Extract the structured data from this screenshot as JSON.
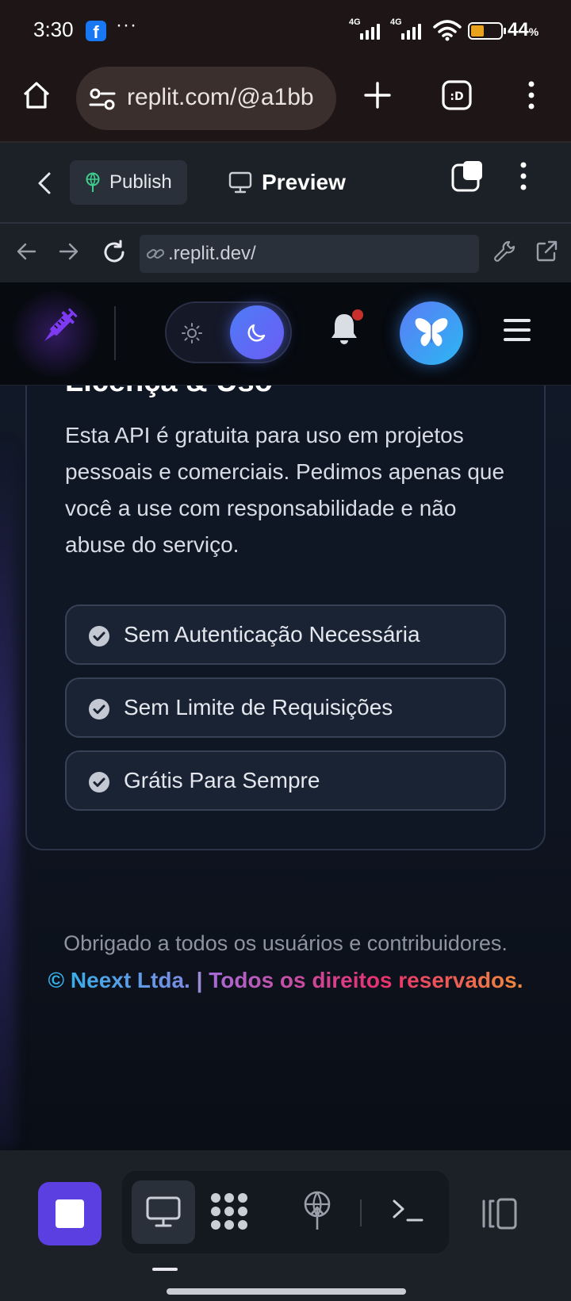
{
  "status_bar": {
    "time": "3:30",
    "more": "···",
    "sim1_label": "4G",
    "sim2_label": "4G",
    "battery_percent": "44",
    "battery_unit": "%",
    "battery_level": 0.44
  },
  "browser": {
    "url": "replit.com/@a1bb"
  },
  "replit_header": {
    "publish_label": "Publish",
    "preview_label": "Preview"
  },
  "webview": {
    "url": ".replit.dev/"
  },
  "license_card": {
    "title": "Licença & Uso",
    "description": "Esta API é gratuita para uso em projetos pessoais e comerciais. Pedimos apenas que você a use com responsabilidade e não abuse do serviço.",
    "features": [
      "Sem Autenticação Necessária",
      "Sem Limite de Requisições",
      "Grátis Para Sempre"
    ]
  },
  "footer": {
    "thanks": "Obrigado a todos os usuários e contribuidores.",
    "copyright": "© Neext Ltda.",
    "separator": "|",
    "rights": "Todos os direitos reservados."
  },
  "colors": {
    "accent_purple": "#5b3fe0",
    "brand_syringe": "#7e3af2",
    "avatar_gradient_start": "#5b7bf6",
    "avatar_gradient_end": "#2bb7f2",
    "notification_dot": "#c9302c"
  },
  "icons": {
    "status": [
      "facebook-icon",
      "signal-icon",
      "wifi-icon",
      "battery-icon"
    ],
    "browser": [
      "home-icon",
      "site-settings-icon",
      "new-tab-icon",
      "tab-switcher-icon",
      "menu-icon"
    ],
    "replit": [
      "back-icon",
      "publish-icon",
      "preview-monitor-icon",
      "tabs-icon",
      "kebab-icon"
    ],
    "webview": [
      "arrow-left-icon",
      "arrow-right-icon",
      "reload-icon",
      "link-icon",
      "wrench-icon",
      "external-link-icon"
    ],
    "site": [
      "syringe-logo-icon",
      "sun-icon",
      "moon-icon",
      "bell-icon",
      "butterfly-icon",
      "hamburger-icon"
    ],
    "bottom": [
      "stop-icon",
      "monitor-icon",
      "apps-grid-icon",
      "deploy-icon",
      "terminal-icon",
      "layout-toggle-icon"
    ]
  }
}
